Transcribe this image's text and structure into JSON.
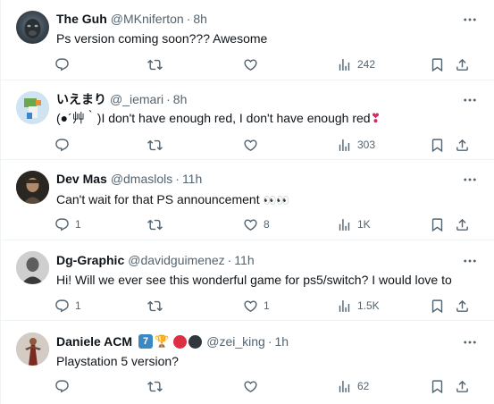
{
  "tweets": [
    {
      "name": "The Guh",
      "handle": "@MKniferton",
      "sep": "·",
      "time": "8h",
      "text": "Ps version coming soon??? Awesome",
      "replies": "",
      "retweets": "",
      "likes": "",
      "views": "242"
    },
    {
      "name": "いえまり",
      "handle": "@_iemari",
      "sep": "·",
      "time": "8h",
      "text": "(●´艸｀)I don't have enough red, I don't have enough red",
      "emoji": "❣",
      "replies": "",
      "retweets": "",
      "likes": "",
      "views": "303"
    },
    {
      "name": "Dev Mas",
      "handle": "@dmaslols",
      "sep": "·",
      "time": "11h",
      "text": "Can't wait for that PS announcement",
      "emoji": "👀👀",
      "replies": "1",
      "retweets": "",
      "likes": "8",
      "views": "1K"
    },
    {
      "name": "Dg-Graphic",
      "handle": "@davidguimenez",
      "sep": "·",
      "time": "11h",
      "text": "Hi! Will we ever see this wonderful game for ps5/switch? I would love to",
      "replies": "1",
      "retweets": "",
      "likes": "1",
      "views": "1.5K"
    },
    {
      "name": "Daniele ACM",
      "name_badge": "7",
      "name_trophy": "🏆",
      "handle": "@zei_king",
      "sep": "·",
      "time": "1h",
      "text": "Playstation 5 version?",
      "replies": "",
      "retweets": "",
      "likes": "",
      "views": "62"
    }
  ],
  "colors": {
    "text": "#0f1419",
    "muted": "#536471",
    "divider": "#eff3f4",
    "heart_red": "#e0245e",
    "badge_blue": "#3b88c3"
  },
  "icons": [
    "reply-icon",
    "retweet-icon",
    "like-icon",
    "views-icon",
    "bookmark-icon",
    "share-icon",
    "more-icon"
  ]
}
